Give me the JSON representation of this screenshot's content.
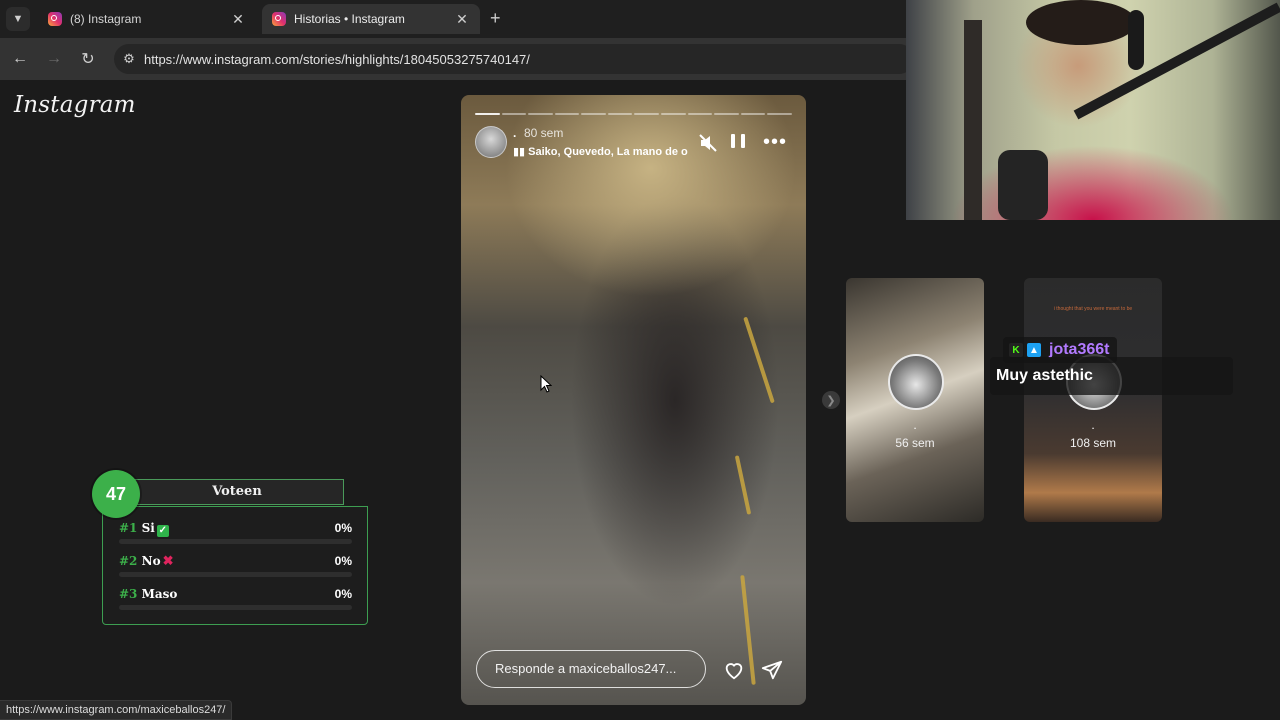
{
  "browser": {
    "tabs": [
      {
        "title": "(8) Instagram",
        "active": false
      },
      {
        "title": "Historias • Instagram",
        "active": true
      }
    ],
    "url": "https://www.instagram.com/stories/highlights/18045053275740147/",
    "status_url": "https://www.instagram.com/maxiceballos247/"
  },
  "page": {
    "logo": "Instagram"
  },
  "story": {
    "user": ".",
    "time": "80 sem",
    "music": "Saiko, Quevedo, La mano de oro",
    "reply_placeholder": "Responde a maxiceballos247...",
    "segments": 12,
    "current_segment": 1
  },
  "next_stories": [
    {
      "dot": ".",
      "time": "56 sem"
    },
    {
      "dot": ".",
      "time": "108 sem",
      "caption": "i thought that you were meant to be"
    }
  ],
  "chat": {
    "username": "jota366t",
    "message": "Muy astethic"
  },
  "poll": {
    "title": "Voteen",
    "count": "47",
    "options": [
      {
        "rank": "#1",
        "label": "Si",
        "emoji": "check",
        "percent": "0%",
        "fill": 0
      },
      {
        "rank": "#2",
        "label": "No",
        "emoji": "cross",
        "percent": "0%",
        "fill": 0
      },
      {
        "rank": "#3",
        "label": "Maso",
        "emoji": "",
        "percent": "0%",
        "fill": 0
      }
    ]
  },
  "colors": {
    "accent_green": "#3cb04a",
    "chat_user": "#b27aff",
    "background": "#1b1b1b"
  }
}
